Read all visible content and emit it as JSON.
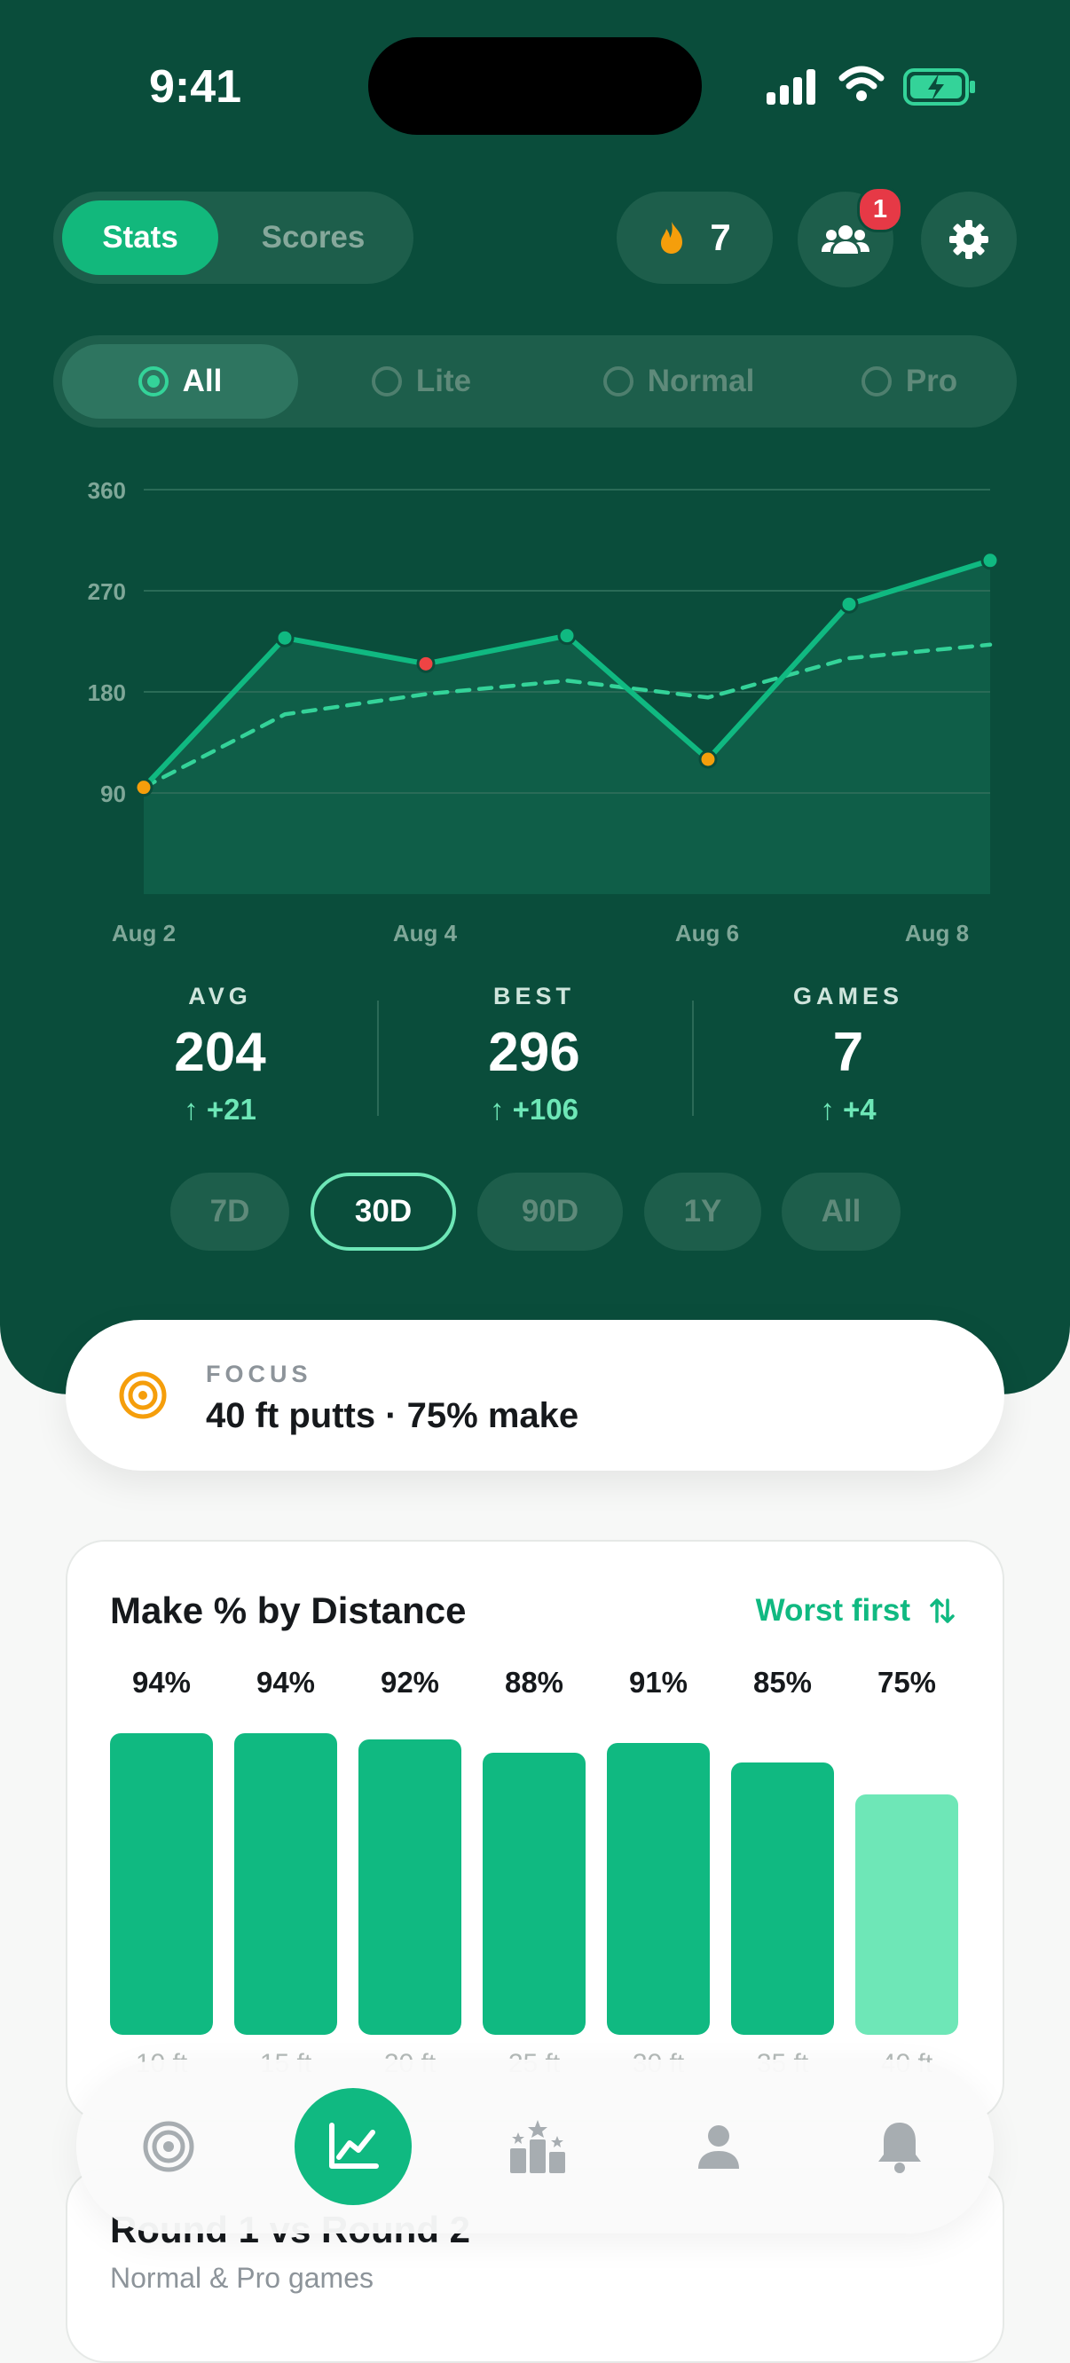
{
  "status": {
    "time": "9:41"
  },
  "header": {
    "tabs": [
      "Stats",
      "Scores"
    ],
    "active_tab": "Stats",
    "streak": "7",
    "notifications_badge": "1"
  },
  "filter": {
    "options": [
      "All",
      "Lite",
      "Normal",
      "Pro"
    ],
    "selected": "All"
  },
  "chart_data": {
    "type": "line",
    "x": [
      "Aug 2",
      "Aug 3",
      "Aug 4",
      "Aug 5",
      "Aug 6",
      "Aug 6",
      "Aug 7",
      "Aug 8"
    ],
    "x_tick_labels": [
      "Aug 2",
      "Aug 4",
      "Aug 6",
      "Aug 8"
    ],
    "y_ticks": [
      90,
      180,
      270,
      360
    ],
    "ylim": [
      0,
      360
    ],
    "series": [
      {
        "values": [
          95,
          228,
          205,
          230,
          120,
          258,
          297
        ],
        "style": "solid"
      },
      {
        "values": [
          95,
          160,
          178,
          190,
          175,
          210,
          222
        ],
        "style": "dashed"
      }
    ],
    "point_colors": [
      "#f59e0b",
      "#10b981",
      "#ef4444",
      "#10b981",
      "#f59e0b",
      "#10b981",
      "#10b981"
    ]
  },
  "stats": [
    {
      "label": "AVG",
      "value": "204",
      "delta": "+21"
    },
    {
      "label": "BEST",
      "value": "296",
      "delta": "+106"
    },
    {
      "label": "GAMES",
      "value": "7",
      "delta": "+4"
    }
  ],
  "ranges": [
    "7D",
    "30D",
    "90D",
    "1Y",
    "All"
  ],
  "active_range": "30D",
  "focus": {
    "label": "FOCUS",
    "text": "40 ft putts · 75% make"
  },
  "make_card": {
    "title": "Make % by Distance",
    "sort_label": "Worst first",
    "bars": [
      {
        "label": "94%",
        "value": 94,
        "x": "10 ft"
      },
      {
        "label": "94%",
        "value": 94,
        "x": "15 ft"
      },
      {
        "label": "92%",
        "value": 92,
        "x": "20 ft"
      },
      {
        "label": "88%",
        "value": 88,
        "x": "25 ft"
      },
      {
        "label": "91%",
        "value": 91,
        "x": "30 ft"
      },
      {
        "label": "85%",
        "value": 85,
        "x": "35 ft"
      },
      {
        "label": "75%",
        "value": 75,
        "x": "40 ft",
        "highlight": true
      }
    ]
  },
  "rounds_card": {
    "title": "Round 1 vs Round 2",
    "subtitle": "Normal & Pro games"
  },
  "tabbar": {
    "items": [
      "target-icon",
      "chart-icon",
      "leaderboard-icon",
      "profile-icon",
      "bell-icon"
    ],
    "active": "chart-icon"
  },
  "colors": {
    "hero": "#0a4d3b",
    "accent": "#10b981",
    "accent_light": "#6ee7b7",
    "warning": "#f59e0b",
    "danger": "#ef4444"
  }
}
